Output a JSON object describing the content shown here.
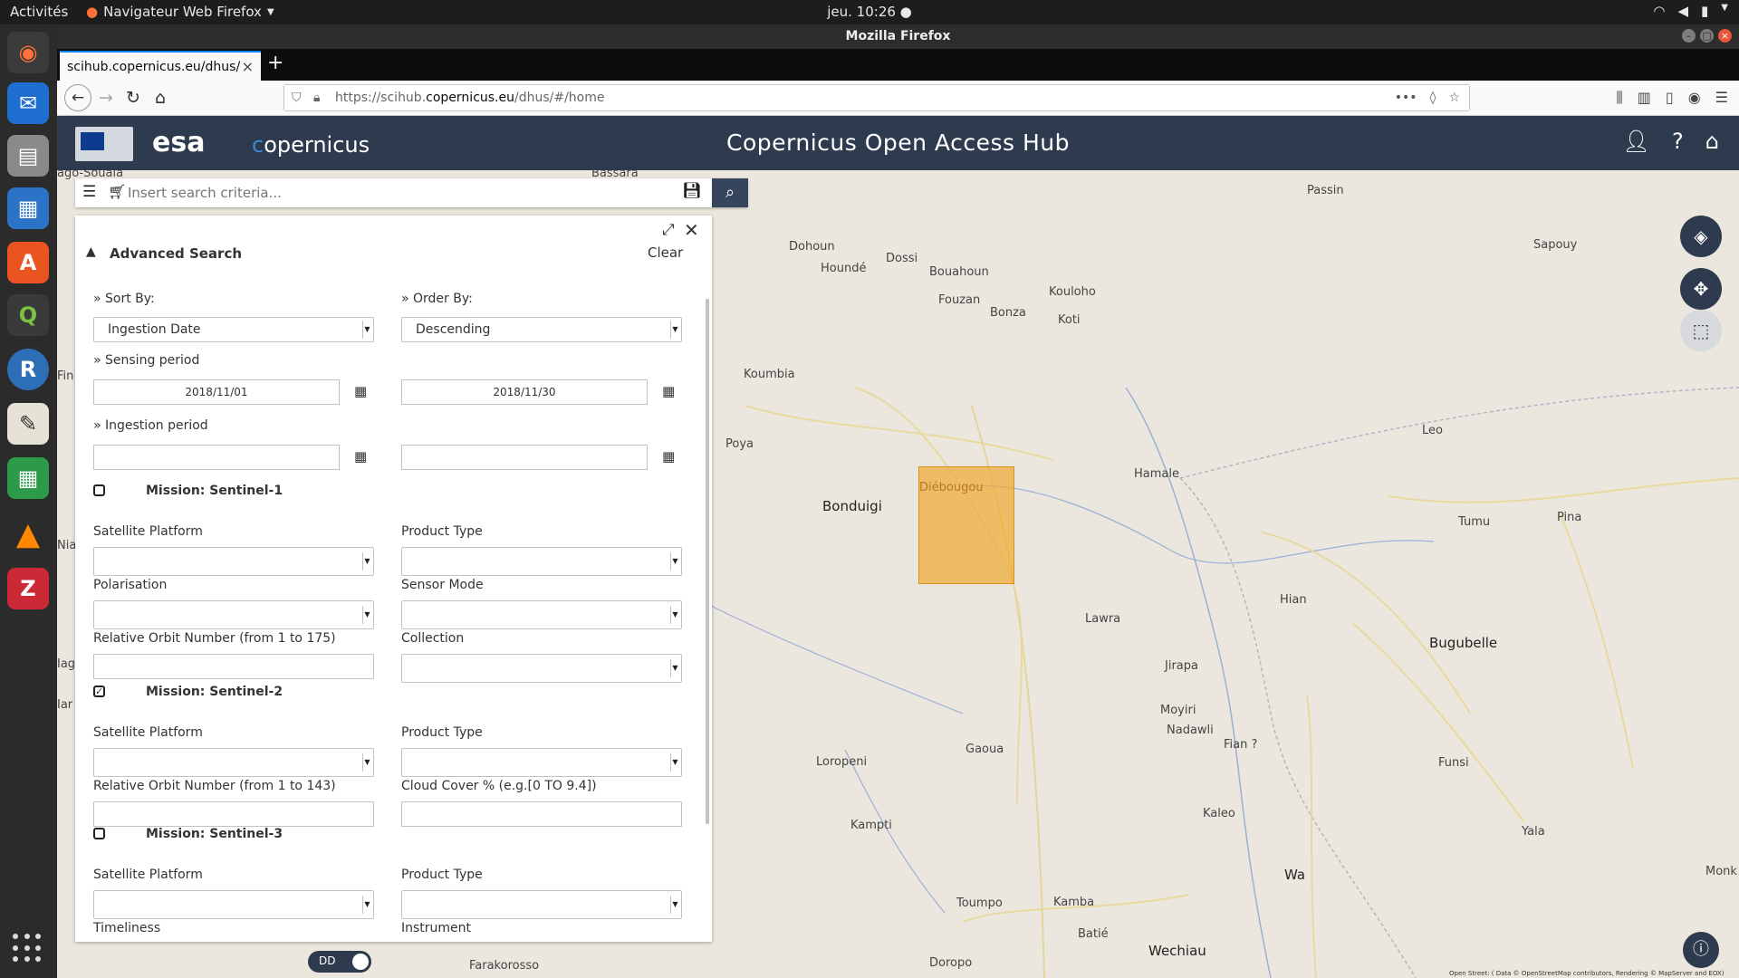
{
  "system": {
    "activities": "Activités",
    "app_name": "Navigateur Web Firefox",
    "clock": "jeu. 10:26 ●"
  },
  "window": {
    "title": "Mozilla Firefox"
  },
  "browser": {
    "tab_title": "scihub.copernicus.eu/dhus/",
    "url_prefix": "https://scihub.",
    "url_domain": "copernicus.eu",
    "url_suffix": "/dhus/#/home"
  },
  "app": {
    "title": "Copernicus Open Access Hub",
    "esa": "esa",
    "copernicus": "opernicus"
  },
  "search": {
    "placeholder": "Insert search criteria..."
  },
  "advanced": {
    "title": "Advanced Search",
    "clear": "Clear",
    "sort_by_label": "» Sort By:",
    "sort_by_value": "Ingestion Date",
    "order_by_label": "» Order By:",
    "order_by_value": "Descending",
    "sensing_label": "» Sensing period",
    "sensing_from": "2018/11/01",
    "sensing_to": "2018/11/30",
    "ingestion_label": "» Ingestion period",
    "s1": {
      "title": "Mission: Sentinel-1",
      "checked": false,
      "platform": "Satellite Platform",
      "product": "Product Type",
      "polarisation": "Polarisation",
      "sensor_mode": "Sensor Mode",
      "orbit": "Relative Orbit Number (from 1 to 175)",
      "collection": "Collection"
    },
    "s2": {
      "title": "Mission: Sentinel-2",
      "checked": true,
      "platform": "Satellite Platform",
      "product": "Product Type",
      "orbit": "Relative Orbit Number (from 1 to 143)",
      "cloud": "Cloud Cover % (e.g.[0 TO 9.4])"
    },
    "s3": {
      "title": "Mission: Sentinel-3",
      "checked": false,
      "platform": "Satellite Platform",
      "product": "Product Type",
      "timeliness": "Timeliness",
      "instrument": "Instrument"
    }
  },
  "toggle": {
    "label": "DD"
  },
  "map": {
    "places": [
      "Passin",
      "Sapouy",
      "Dohoun",
      "Dossi",
      "Houndé",
      "Bouahoun",
      "Kouloho",
      "Fouzan",
      "Bonza",
      "Koti",
      "Koumbia",
      "Leo",
      "Poya",
      "Hamale",
      "Bonduigi",
      "Diébougou",
      "Tumu",
      "Pina",
      "Hian",
      "Lawra",
      "Bugubelle",
      "Jirapa",
      "Moyiri",
      "Nadawli",
      "Fian ?",
      "Loropeni",
      "Gaoua",
      "Funsi",
      "Kampti",
      "Kaleo",
      "Yala",
      "Wa",
      "Monk",
      "Toumpo",
      "Kamba",
      "Batié",
      "Wechiau",
      "Doropo",
      "Farakorosso",
      "ago-Souala",
      "Bassara",
      "Fin",
      "Nia",
      "Iagi",
      "Iar"
    ],
    "attribution": "Open Street: ( Data © OpenStreetMap contributors, Rendering © MapServer and EOX)"
  }
}
